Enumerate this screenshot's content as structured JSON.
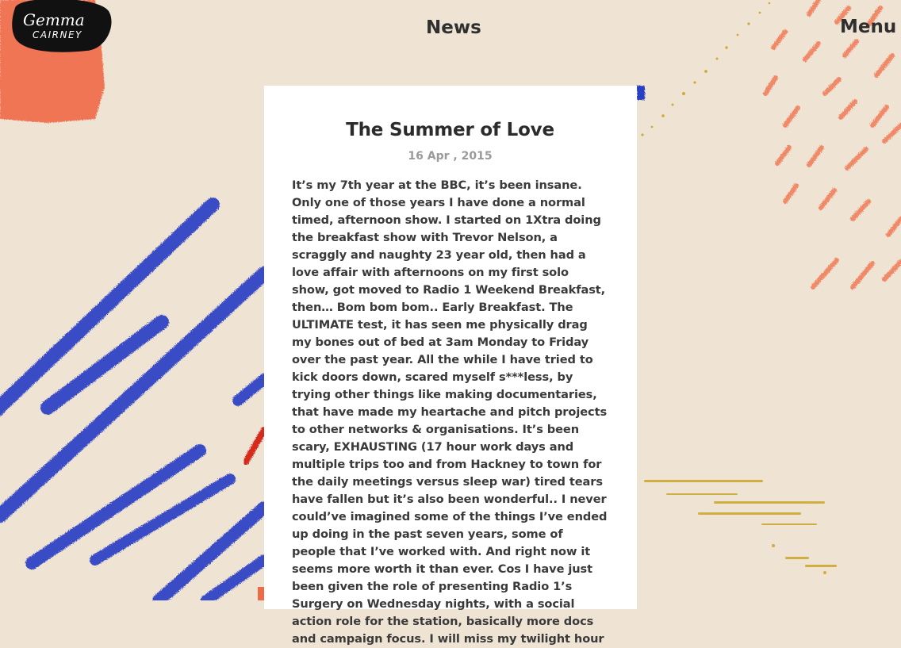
{
  "header": {
    "logo_text_line1": "Gemma",
    "logo_text_line2": "CAIRNEY",
    "nav_news": "News",
    "nav_menu": "Menu"
  },
  "post": {
    "title": "The Summer of Love",
    "date": "16 Apr , 2015",
    "body": "It’s my 7th year at the BBC, it’s been insane. Only one of those years I have done a normal timed, afternoon show. I started on 1Xtra doing the breakfast show with Trevor Nelson, a scraggly and naughty 23 year old, then had a love affair with afternoons on my first solo show, got moved to Radio 1 Weekend Breakfast, then… Bom bom bom.. Early Breakfast. The ULTIMATE test, it has seen me physically drag my bones out of bed at 3am Monday to Friday over the past year. All the while I have tried to kick doors down, scared myself s***less, by trying other things like making documentaries, that have made my heartache and pitch projects to other networks & organisations. It’s been scary, EXHAUSTING (17 hour work days and multiple trips too and from Hackney to town for the daily meetings versus sleep war) tired tears have fallen but it’s also been wonderful.. I never could’ve imagined some of the things I’ve ended up doing in the past seven years, some of people that I’ve worked with. And right now it seems more worth it than ever. Cos I have just been given the role of presenting Radio 1’s Surgery on Wednesday nights, with a social action role for the station, basically more docs and campaign focus. I will miss my twilight hour"
  },
  "colors": {
    "background": "#efe3d4",
    "orange_chalk": "#ef6a47",
    "blue_chalk": "#2a3fc4",
    "gold_speckle": "#c9a11f",
    "red_chalk": "#d62a1e",
    "logo_black": "#111111"
  }
}
